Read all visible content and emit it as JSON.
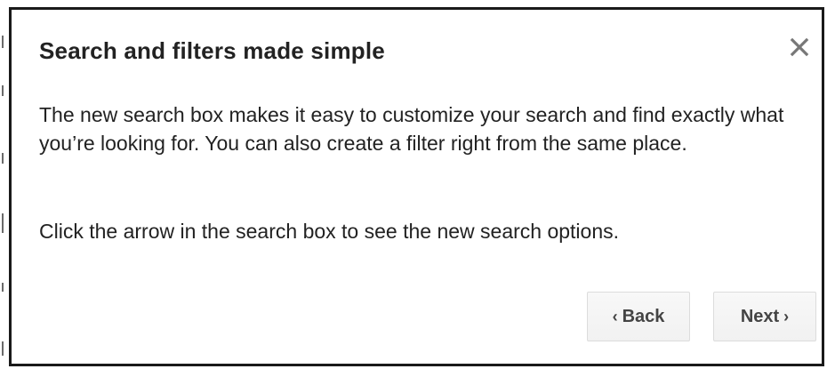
{
  "dialog": {
    "title": "Search and filters made simple",
    "paragraph_1": "The new search box makes it easy to customize your search and find exactly what you’re looking for. You can also create a filter right from the same place.",
    "paragraph_2": "Click the arrow in the search box to see the new search options.",
    "close_icon": "close-icon"
  },
  "buttons": {
    "back": {
      "chevron": "‹",
      "label": "Back"
    },
    "next": {
      "label": "Next",
      "chevron": "›"
    }
  },
  "colors": {
    "text": "#222222",
    "button_text": "#444444",
    "button_border": "#dcdcdc",
    "close_icon": "#777777",
    "frame_border": "#1a1a1a"
  }
}
